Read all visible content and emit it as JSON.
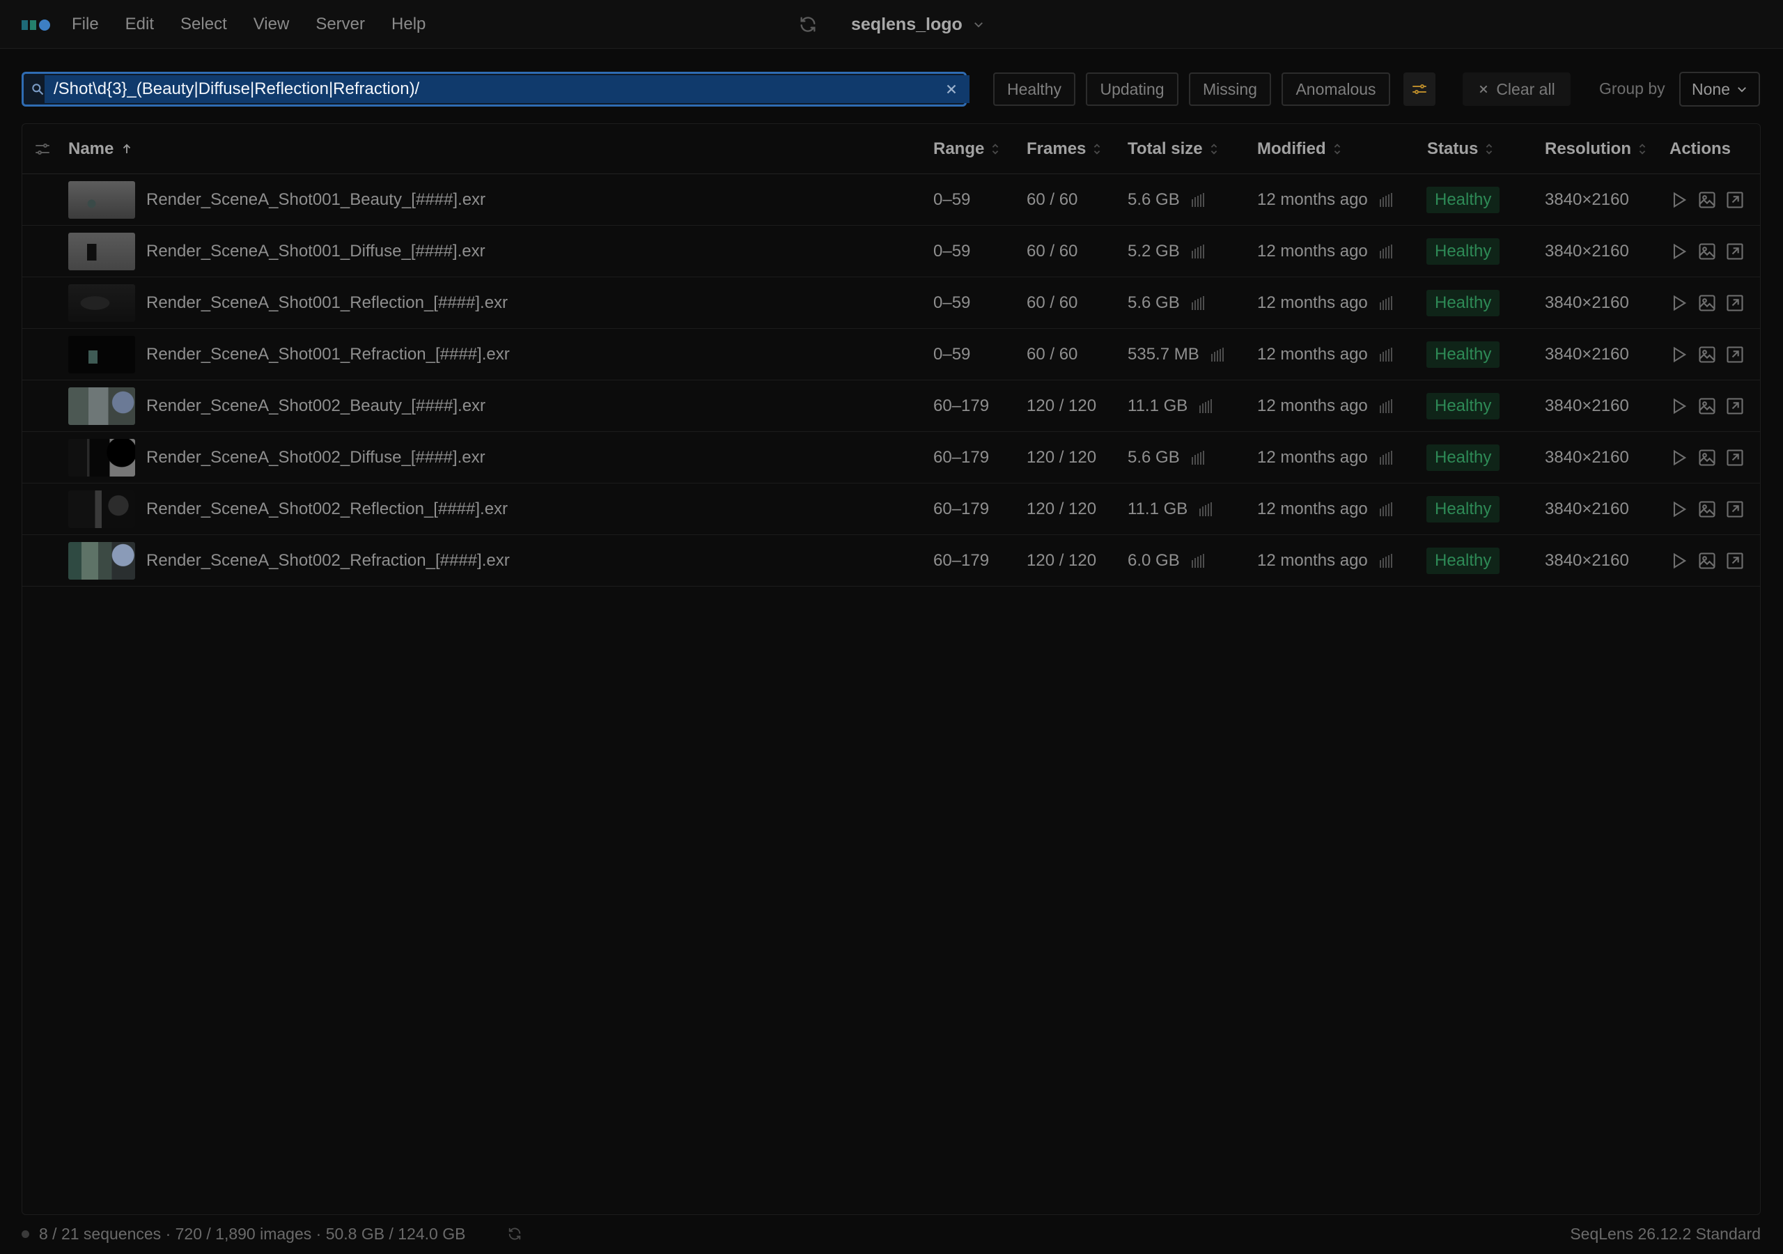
{
  "menubar": {
    "logo_icon": "seqlens-logo-icon",
    "items": [
      "File",
      "Edit",
      "Select",
      "View",
      "Server",
      "Help"
    ],
    "project": {
      "title": "seqlens_logo",
      "sync_icon": "sync-icon",
      "chevron_icon": "chevron-down-icon"
    }
  },
  "filter": {
    "search_value": "/Shot\\d{3}_(Beauty|Diffuse|Reflection|Refraction)/",
    "chips": [
      "Healthy",
      "Updating",
      "Missing",
      "Anomalous"
    ],
    "settings_icon": "filter-settings-icon",
    "clear_all": "Clear all",
    "group_by_label": "Group by",
    "group_by_value": "None"
  },
  "table": {
    "columns": {
      "name": "Name",
      "range": "Range",
      "frames": "Frames",
      "total_size": "Total size",
      "modified": "Modified",
      "status": "Status",
      "resolution": "Resolution",
      "actions": "Actions"
    },
    "rows": [
      {
        "name": "Render_SceneA_Shot001_Beauty_[####].exr",
        "range": "0–59",
        "frames": "60 / 60",
        "size": "5.6 GB",
        "modified": "12 months ago",
        "status": "Healthy",
        "resolution": "3840×2160"
      },
      {
        "name": "Render_SceneA_Shot001_Diffuse_[####].exr",
        "range": "0–59",
        "frames": "60 / 60",
        "size": "5.2 GB",
        "modified": "12 months ago",
        "status": "Healthy",
        "resolution": "3840×2160"
      },
      {
        "name": "Render_SceneA_Shot001_Reflection_[####].exr",
        "range": "0–59",
        "frames": "60 / 60",
        "size": "5.6 GB",
        "modified": "12 months ago",
        "status": "Healthy",
        "resolution": "3840×2160"
      },
      {
        "name": "Render_SceneA_Shot001_Refraction_[####].exr",
        "range": "0–59",
        "frames": "60 / 60",
        "size": "535.7 MB",
        "modified": "12 months ago",
        "status": "Healthy",
        "resolution": "3840×2160"
      },
      {
        "name": "Render_SceneA_Shot002_Beauty_[####].exr",
        "range": "60–179",
        "frames": "120 / 120",
        "size": "11.1 GB",
        "modified": "12 months ago",
        "status": "Healthy",
        "resolution": "3840×2160"
      },
      {
        "name": "Render_SceneA_Shot002_Diffuse_[####].exr",
        "range": "60–179",
        "frames": "120 / 120",
        "size": "5.6 GB",
        "modified": "12 months ago",
        "status": "Healthy",
        "resolution": "3840×2160"
      },
      {
        "name": "Render_SceneA_Shot002_Reflection_[####].exr",
        "range": "60–179",
        "frames": "120 / 120",
        "size": "11.1 GB",
        "modified": "12 months ago",
        "status": "Healthy",
        "resolution": "3840×2160"
      },
      {
        "name": "Render_SceneA_Shot002_Refraction_[####].exr",
        "range": "60–179",
        "frames": "120 / 120",
        "size": "6.0 GB",
        "modified": "12 months ago",
        "status": "Healthy",
        "resolution": "3840×2160"
      }
    ]
  },
  "statusbar": {
    "stats": "8 / 21 sequences · 720 / 1,890 images · 50.8 GB / 124.0 GB",
    "version": "SeqLens 26.12.2 Standard"
  },
  "colors": {
    "accent": "#2f6cb3",
    "healthy": "#2e8a56",
    "background": "#0b0b0b"
  }
}
